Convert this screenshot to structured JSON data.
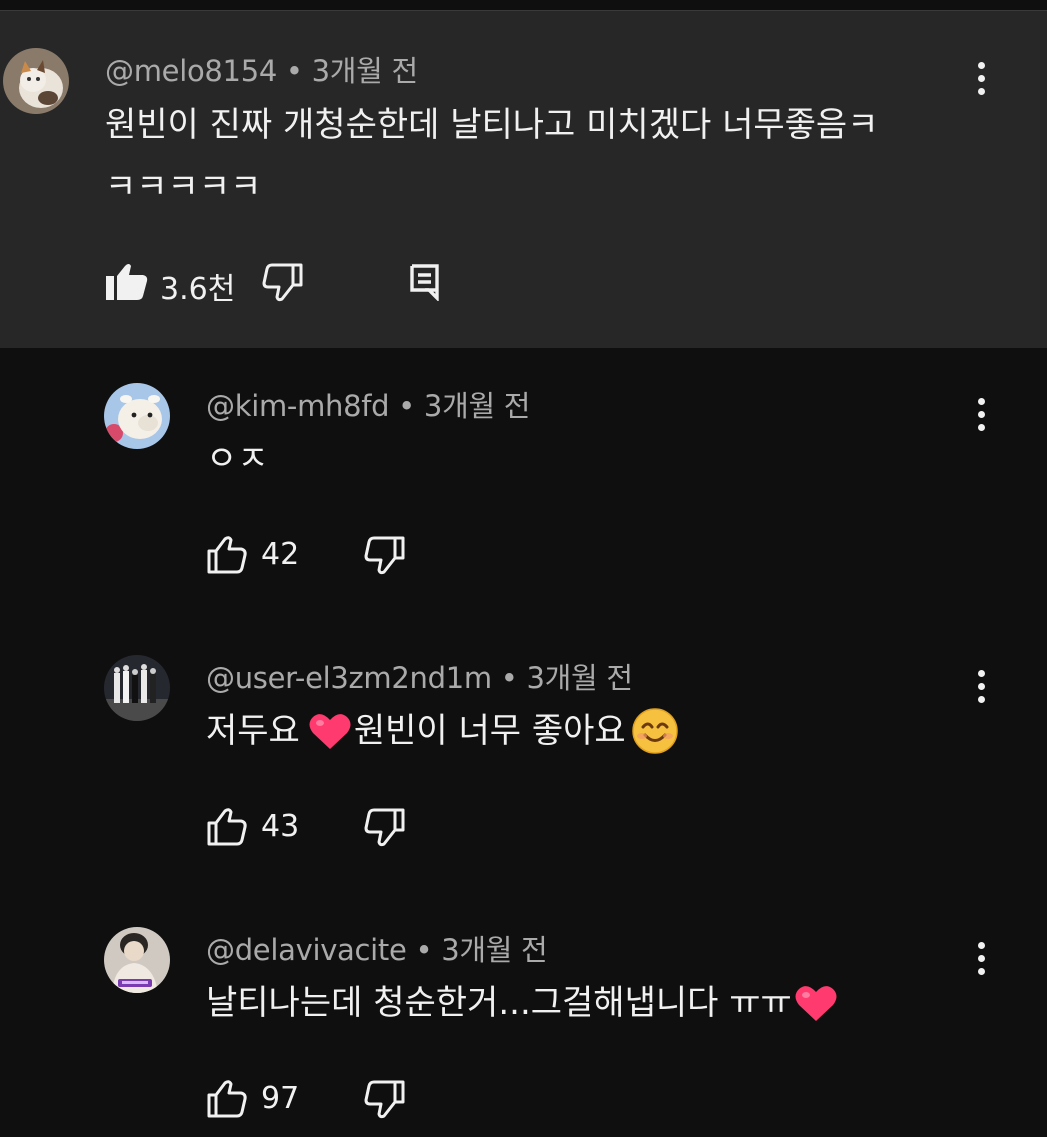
{
  "comments": [
    {
      "author": "@melo8154",
      "time": "3개월 전",
      "text_line1": "원빈이 진짜 개청순한데 날티나고 미치겠다 너무좋음ㅋ",
      "text_line2": "ㅋㅋㅋㅋㅋ",
      "likes": "3.6천",
      "liked": true
    },
    {
      "author": "@kim-mh8fd",
      "time": "3개월 전",
      "text": "ㅇㅈ",
      "likes": "42"
    },
    {
      "author": "@user-el3zm2nd1m",
      "time": "3개월 전",
      "text_a": "저두요 ",
      "text_b": "원빈이 너무 좋아요 ",
      "likes": "43"
    },
    {
      "author": "@delavivacite",
      "time": "3개월 전",
      "text_a": "날티나는데 청순한거...그걸해냅니다 ㅠㅠ",
      "likes": "97"
    }
  ],
  "separator": " • ",
  "colors": {
    "background": "#0f0f0f",
    "highlight": "#272727",
    "meta_text": "#aaaaaa",
    "text": "#f1f1f1",
    "heart": "#ff3a6e"
  },
  "icons": [
    "thumb-up-filled-icon",
    "thumb-down-icon",
    "reply-icon",
    "more-vert-icon",
    "thumb-up-icon",
    "heart-emoji-icon",
    "smile-emoji-icon"
  ]
}
